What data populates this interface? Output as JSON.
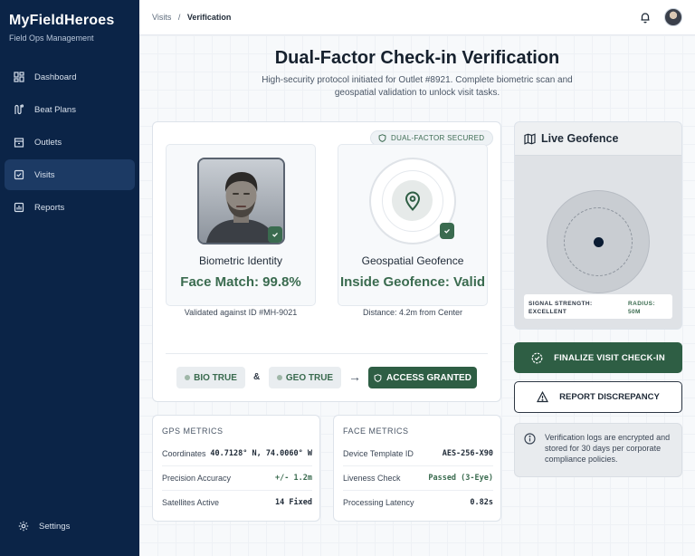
{
  "app": {
    "title": "MyFieldHeroes",
    "subtitle": "Field Ops Management"
  },
  "sidebar": {
    "items": [
      {
        "label": "Dashboard",
        "icon": "dashboard-icon",
        "active": false
      },
      {
        "label": "Beat Plans",
        "icon": "route-icon",
        "active": false
      },
      {
        "label": "Outlets",
        "icon": "store-icon",
        "active": false
      },
      {
        "label": "Visits",
        "icon": "checklist-icon",
        "active": true
      },
      {
        "label": "Reports",
        "icon": "chart-icon",
        "active": false
      }
    ],
    "settings_label": "Settings"
  },
  "header": {
    "breadcrumb_parent": "Visits",
    "breadcrumb_sep": "/",
    "breadcrumb_current": "Verification"
  },
  "main": {
    "title": "Dual-Factor Check-in Verification",
    "subtitle": "High-security protocol initiated for Outlet #8921. Complete biometric scan and geospatial validation to unlock visit tasks.",
    "badge": "DUAL-FACTOR SECURED",
    "biometric": {
      "label": "Biometric Identity",
      "value": "Face Match: 99.8%",
      "note": "Validated against ID #MH-9021"
    },
    "geospatial": {
      "label": "Geospatial Geofence",
      "value": "Inside Geofence: Valid",
      "note": "Distance: 4.2m from Center"
    },
    "logic": {
      "bio_chip": "BIO TRUE",
      "and": "&",
      "arrow": "→",
      "geo_chip": "GEO TRUE",
      "result": "ACCESS GRANTED"
    },
    "gps_metrics": {
      "title": "GPS METRICS",
      "rows": [
        {
          "label": "Coordinates",
          "value": "40.7128° N, 74.0060° W"
        },
        {
          "label": "Precision Accuracy",
          "value": "+/- 1.2m"
        },
        {
          "label": "Satellites Active",
          "value": "14 Fixed"
        }
      ]
    },
    "face_metrics": {
      "title": "FACE METRICS",
      "rows": [
        {
          "label": "Device Template ID",
          "value": "AES-256-X90"
        },
        {
          "label": "Liveness Check",
          "value": "Passed (3-Eye)"
        },
        {
          "label": "Processing Latency",
          "value": "0.82s"
        }
      ]
    }
  },
  "right": {
    "geofence_title": "Live Geofence",
    "signal_label_1": "SIGNAL STRENGTH:",
    "signal_value": "EXCELLENT",
    "radius_label": "RADIUS:",
    "radius_value": "50M",
    "finalize_label": "FINALIZE VISIT CHECK-IN",
    "report_label": "REPORT DISCREPANCY",
    "info_text": "Verification logs are encrypted and stored for 30 days per corporate compliance policies."
  },
  "colors": {
    "sidebar": "#0b2447",
    "accent": "#2e5e44",
    "success_text": "#3a6b4f"
  }
}
